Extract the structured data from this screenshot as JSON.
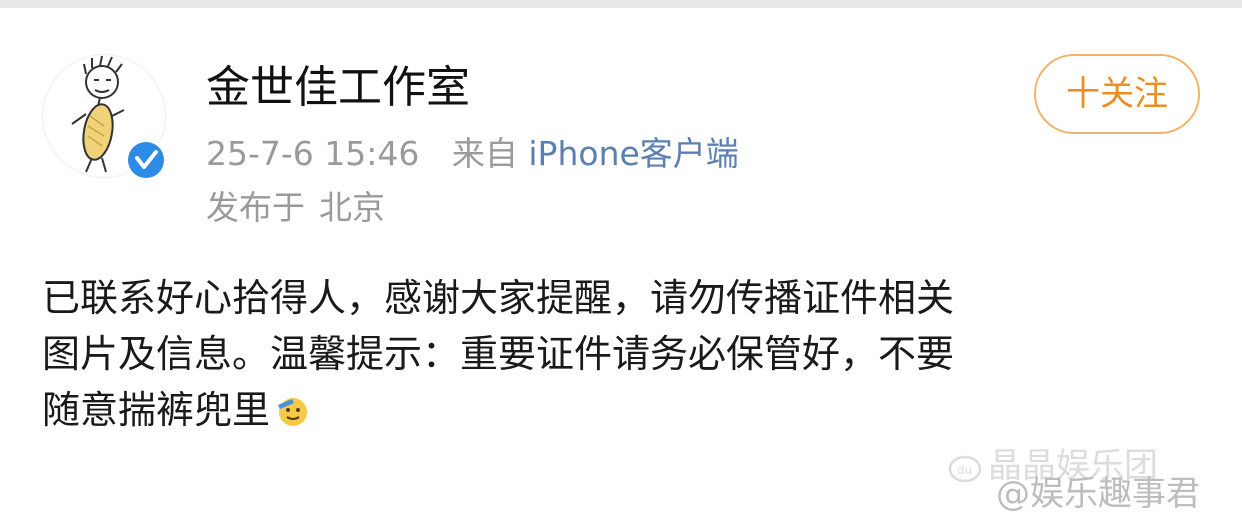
{
  "post": {
    "author": "金世佳工作室",
    "time": "25-7-6 15:46",
    "source_prefix": "来自",
    "source_app": "iPhone客户端",
    "location_prefix": "发布于",
    "location": "北京",
    "follow_label": "十关注",
    "content_lines": [
      "已联系好心拾得人，感谢大家提醒，请勿传播证件相关",
      "图片及信息。温馨提示：重要证件请务必保管好，不要",
      "随意揣裤兜里"
    ],
    "emoji_icon": "salute-face-icon",
    "verified_icon": "verified-badge-icon"
  },
  "watermark": {
    "line1": "晶晶娱乐团",
    "line2": "@娱乐趣事君"
  },
  "colors": {
    "follow": "#ec8f23",
    "follow_border": "#f0b36a",
    "meta": "#9a9a9a",
    "verified": "#2b8be6"
  }
}
